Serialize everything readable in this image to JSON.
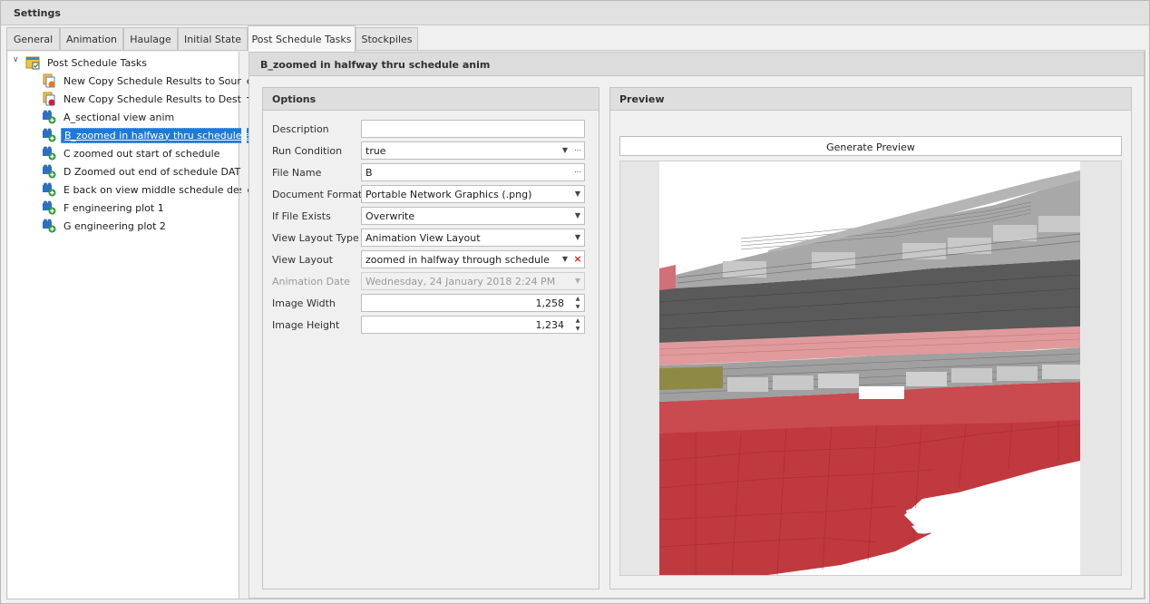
{
  "window": {
    "title": "Settings"
  },
  "tabs": [
    {
      "label": "General",
      "active": false
    },
    {
      "label": "Animation",
      "active": false
    },
    {
      "label": "Haulage",
      "active": false
    },
    {
      "label": "Initial State",
      "active": false
    },
    {
      "label": "Post Schedule Tasks",
      "active": true
    },
    {
      "label": "Stockpiles",
      "active": false
    }
  ],
  "tree": {
    "root": {
      "label": "Post Schedule Tasks",
      "icon": "task-folder-icon",
      "expanded": true
    },
    "items": [
      {
        "label": "New Copy Schedule Results to Source...",
        "icon": "copy-source-icon"
      },
      {
        "label": "New Copy Schedule Results to Destin...",
        "icon": "copy-destination-icon"
      },
      {
        "label": "A_sectional view anim",
        "icon": "view-export-icon"
      },
      {
        "label": "B_zoomed in halfway thru schedule a...",
        "icon": "view-export-icon",
        "selected": true
      },
      {
        "label": "C zoomed out start of schedule",
        "icon": "view-export-icon"
      },
      {
        "label": "D Zoomed out end of schedule DATE",
        "icon": "view-export-icon"
      },
      {
        "label": "E back on view middle schedule desig...",
        "icon": "view-export-icon"
      },
      {
        "label": "F engineering plot 1",
        "icon": "view-export-icon"
      },
      {
        "label": "G engineering plot 2",
        "icon": "view-export-icon"
      }
    ]
  },
  "detail": {
    "title": "B_zoomed in halfway thru schedule anim"
  },
  "options": {
    "header": "Options",
    "fields": {
      "description": {
        "label": "Description",
        "value": ""
      },
      "run_condition": {
        "label": "Run Condition",
        "value": "true"
      },
      "file_name": {
        "label": "File Name",
        "value": "B"
      },
      "document_format": {
        "label": "Document Format",
        "value": "Portable Network Graphics (.png)"
      },
      "if_file_exists": {
        "label": "If File Exists",
        "value": "Overwrite"
      },
      "view_layout_type": {
        "label": "View Layout Type",
        "value": "Animation View Layout"
      },
      "view_layout": {
        "label": "View Layout",
        "value": "zoomed in halfway through schedule"
      },
      "animation_date": {
        "label": "Animation Date",
        "value": "Wednesday, 24 January 2018 2:24 PM",
        "disabled": true
      },
      "image_width": {
        "label": "Image Width",
        "value": "1,258"
      },
      "image_height": {
        "label": "Image Height",
        "value": "1,234"
      }
    }
  },
  "preview": {
    "header": "Preview",
    "generate_label": "Generate Preview"
  },
  "colors": {
    "selection": "#1e7ad8",
    "clear_x": "#d02020",
    "ore_red": "#c0393f",
    "ore_pink": "#e09a9c",
    "waste_dark": "#5a5a5a",
    "waste_light": "#b8b8b8",
    "olive": "#8e8a46"
  }
}
